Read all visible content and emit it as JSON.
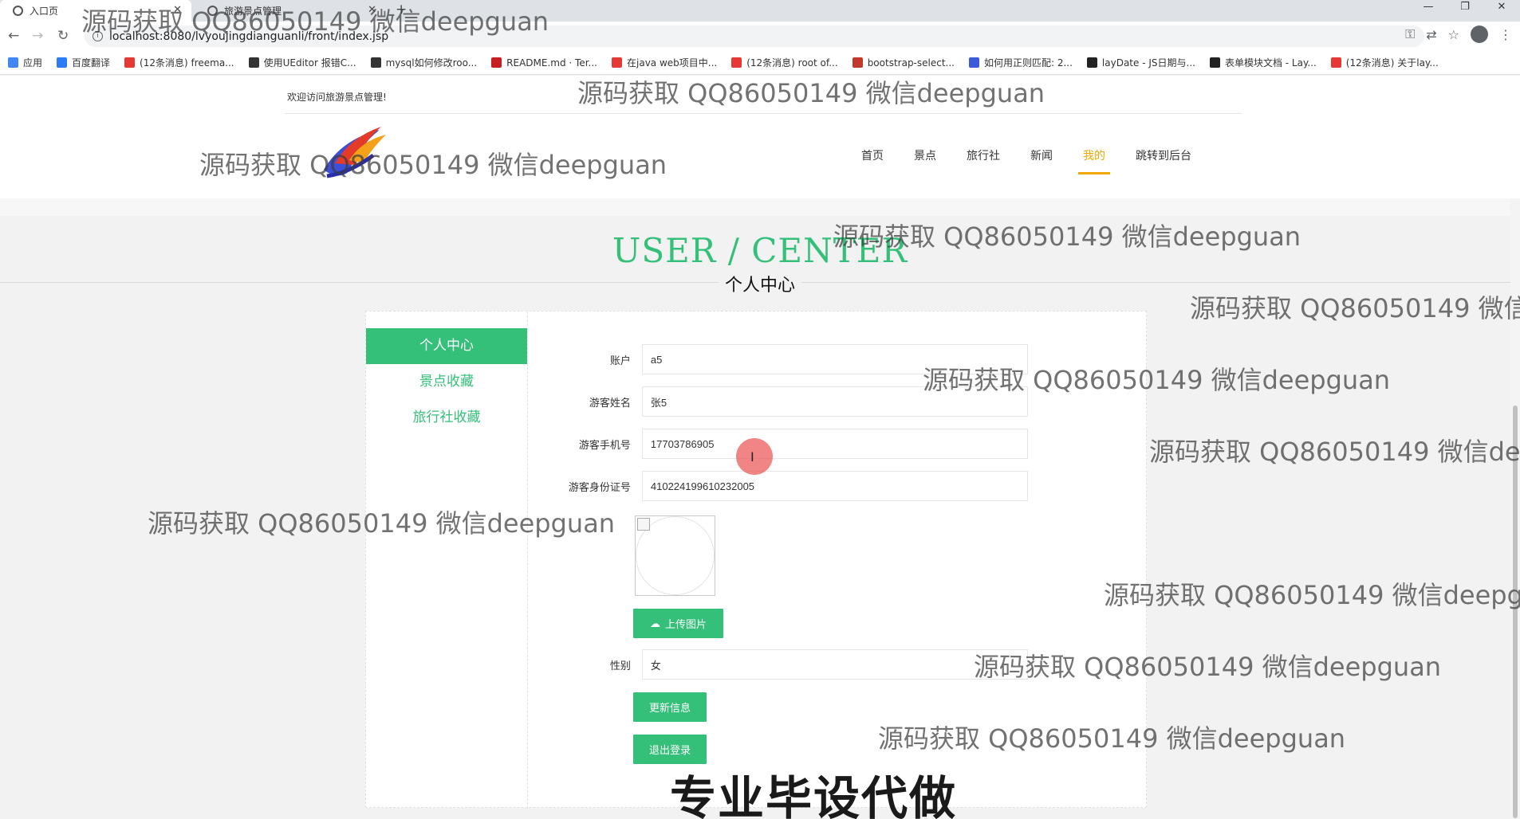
{
  "browser": {
    "tabs": [
      {
        "title": "入口页",
        "active": true
      },
      {
        "title": "旅游景点管理",
        "active": false
      }
    ],
    "new_tab_symbol": "+",
    "url": "localhost:8080/lvyoujingdianguanli/front/index.jsp",
    "bookmarks": [
      {
        "label": "应用",
        "color": "#4285f4"
      },
      {
        "label": "百度翻译",
        "color": "#2b7cf6"
      },
      {
        "label": "(12条消息) freema...",
        "color": "#e53935"
      },
      {
        "label": "使用UEditor 报错C...",
        "color": "#333333"
      },
      {
        "label": "mysql如何修改roo...",
        "color": "#333333"
      },
      {
        "label": "README.md · Ter...",
        "color": "#c71d23"
      },
      {
        "label": "在java web项目中...",
        "color": "#e53935"
      },
      {
        "label": "(12条消息) root of...",
        "color": "#e53935"
      },
      {
        "label": "bootstrap-select...",
        "color": "#c0392b"
      },
      {
        "label": "如何用正则匹配: 2...",
        "color": "#3b5bdb"
      },
      {
        "label": "layDate - JS日期与...",
        "color": "#222222"
      },
      {
        "label": "表单模块文档 - Lay...",
        "color": "#222222"
      },
      {
        "label": "(12条消息) 关于lay...",
        "color": "#e53935"
      }
    ]
  },
  "header": {
    "welcome": "欢迎访问旅游景点管理!",
    "nav": [
      {
        "label": "首页",
        "active": false
      },
      {
        "label": "景点",
        "active": false
      },
      {
        "label": "旅行社",
        "active": false
      },
      {
        "label": "新闻",
        "active": false
      },
      {
        "label": "我的",
        "active": true
      },
      {
        "label": "跳转到后台",
        "active": false
      }
    ]
  },
  "hero": {
    "title": "USER / CENTER",
    "subtitle": "个人中心"
  },
  "sidebar": {
    "items": [
      {
        "label": "个人中心",
        "active": true
      },
      {
        "label": "景点收藏",
        "active": false
      },
      {
        "label": "旅行社收藏",
        "active": false
      }
    ]
  },
  "form": {
    "account": {
      "label": "账户",
      "value": "a5"
    },
    "name": {
      "label": "游客姓名",
      "value": "张5"
    },
    "phone": {
      "label": "游客手机号",
      "value": "17703786905"
    },
    "id_card": {
      "label": "游客身份证号",
      "value": "410224199610232005"
    },
    "gender": {
      "label": "性别",
      "value": "女"
    },
    "upload_label": "上传图片",
    "update_label": "更新信息",
    "logout_label": "退出登录"
  },
  "watermark": {
    "text": "源码获取 QQ86050149 微信deepguan",
    "promo": "专业毕设代做"
  },
  "colors": {
    "accent": "#35c07a",
    "nav_active": "#f0a800"
  }
}
